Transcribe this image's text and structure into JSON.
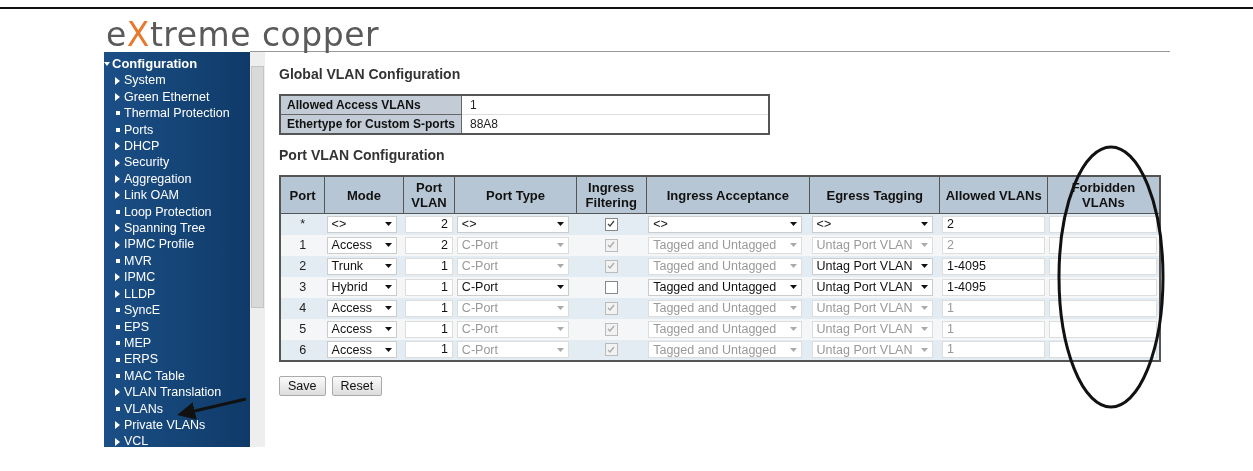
{
  "logo": {
    "parts": [
      {
        "text": "e",
        "accent": false
      },
      {
        "text": "X",
        "accent": true
      },
      {
        "text": "treme copper",
        "accent": false
      }
    ]
  },
  "sidebar": {
    "title": "Configuration",
    "expanded": true,
    "items": [
      {
        "label": "System",
        "kind": "folder"
      },
      {
        "label": "Green Ethernet",
        "kind": "folder"
      },
      {
        "label": "Thermal Protection",
        "kind": "page"
      },
      {
        "label": "Ports",
        "kind": "page"
      },
      {
        "label": "DHCP",
        "kind": "folder"
      },
      {
        "label": "Security",
        "kind": "folder"
      },
      {
        "label": "Aggregation",
        "kind": "folder"
      },
      {
        "label": "Link OAM",
        "kind": "folder"
      },
      {
        "label": "Loop Protection",
        "kind": "page"
      },
      {
        "label": "Spanning Tree",
        "kind": "folder"
      },
      {
        "label": "IPMC Profile",
        "kind": "folder"
      },
      {
        "label": "MVR",
        "kind": "page"
      },
      {
        "label": "IPMC",
        "kind": "folder"
      },
      {
        "label": "LLDP",
        "kind": "folder"
      },
      {
        "label": "SyncE",
        "kind": "page"
      },
      {
        "label": "EPS",
        "kind": "page"
      },
      {
        "label": "MEP",
        "kind": "page"
      },
      {
        "label": "ERPS",
        "kind": "page"
      },
      {
        "label": "MAC Table",
        "kind": "page"
      },
      {
        "label": "VLAN Translation",
        "kind": "folder"
      },
      {
        "label": "VLANs",
        "kind": "page"
      },
      {
        "label": "Private VLANs",
        "kind": "folder"
      },
      {
        "label": "VCL",
        "kind": "folder"
      }
    ]
  },
  "global_vlan": {
    "title": "Global VLAN Configuration",
    "rows": [
      {
        "label": "Allowed Access VLANs",
        "value": "1"
      },
      {
        "label": "Ethertype for Custom S-ports",
        "value": "88A8"
      }
    ]
  },
  "port_vlan": {
    "title": "Port VLAN Configuration",
    "columns": [
      "Port",
      "Mode",
      "Port VLAN",
      "Port Type",
      "Ingress Filtering",
      "Ingress Acceptance",
      "Egress Tagging",
      "Allowed VLANs",
      "Forbidden VLANs"
    ],
    "rows": [
      {
        "port": "*",
        "mode": "<>",
        "port_vlan": "2",
        "port_type": {
          "value": "<>",
          "disabled": false
        },
        "ingress_filtering": {
          "checked": true,
          "disabled": false
        },
        "ingress_acceptance": {
          "value": "<>",
          "disabled": false
        },
        "egress_tagging": {
          "value": "<>",
          "disabled": false
        },
        "allowed_vlans": {
          "value": "2",
          "disabled": false
        }
      },
      {
        "port": "1",
        "mode": "Access",
        "port_vlan": "2",
        "port_type": {
          "value": "C-Port",
          "disabled": true
        },
        "ingress_filtering": {
          "checked": true,
          "disabled": true
        },
        "ingress_acceptance": {
          "value": "Tagged and Untagged",
          "disabled": true
        },
        "egress_tagging": {
          "value": "Untag Port VLAN",
          "disabled": true
        },
        "allowed_vlans": {
          "value": "2",
          "disabled": true
        }
      },
      {
        "port": "2",
        "mode": "Trunk",
        "port_vlan": "1",
        "port_type": {
          "value": "C-Port",
          "disabled": true
        },
        "ingress_filtering": {
          "checked": true,
          "disabled": true
        },
        "ingress_acceptance": {
          "value": "Tagged and Untagged",
          "disabled": true
        },
        "egress_tagging": {
          "value": "Untag Port VLAN",
          "disabled": false
        },
        "allowed_vlans": {
          "value": "1-4095",
          "disabled": false
        }
      },
      {
        "port": "3",
        "mode": "Hybrid",
        "port_vlan": "1",
        "port_type": {
          "value": "C-Port",
          "disabled": false
        },
        "ingress_filtering": {
          "checked": false,
          "disabled": false
        },
        "ingress_acceptance": {
          "value": "Tagged and Untagged",
          "disabled": false
        },
        "egress_tagging": {
          "value": "Untag Port VLAN",
          "disabled": false
        },
        "allowed_vlans": {
          "value": "1-4095",
          "disabled": false
        }
      },
      {
        "port": "4",
        "mode": "Access",
        "port_vlan": "1",
        "port_type": {
          "value": "C-Port",
          "disabled": true
        },
        "ingress_filtering": {
          "checked": true,
          "disabled": true
        },
        "ingress_acceptance": {
          "value": "Tagged and Untagged",
          "disabled": true
        },
        "egress_tagging": {
          "value": "Untag Port VLAN",
          "disabled": true
        },
        "allowed_vlans": {
          "value": "1",
          "disabled": true
        }
      },
      {
        "port": "5",
        "mode": "Access",
        "port_vlan": "1",
        "port_type": {
          "value": "C-Port",
          "disabled": true
        },
        "ingress_filtering": {
          "checked": true,
          "disabled": true
        },
        "ingress_acceptance": {
          "value": "Tagged and Untagged",
          "disabled": true
        },
        "egress_tagging": {
          "value": "Untag Port VLAN",
          "disabled": true
        },
        "allowed_vlans": {
          "value": "1",
          "disabled": true
        }
      },
      {
        "port": "6",
        "mode": "Access",
        "port_vlan": "1",
        "port_type": {
          "value": "C-Port",
          "disabled": true
        },
        "ingress_filtering": {
          "checked": true,
          "disabled": true
        },
        "ingress_acceptance": {
          "value": "Tagged and Untagged",
          "disabled": true
        },
        "egress_tagging": {
          "value": "Untag Port VLAN",
          "disabled": true
        },
        "allowed_vlans": {
          "value": "1",
          "disabled": true
        }
      }
    ]
  },
  "buttons": [
    "Save",
    "Reset"
  ]
}
